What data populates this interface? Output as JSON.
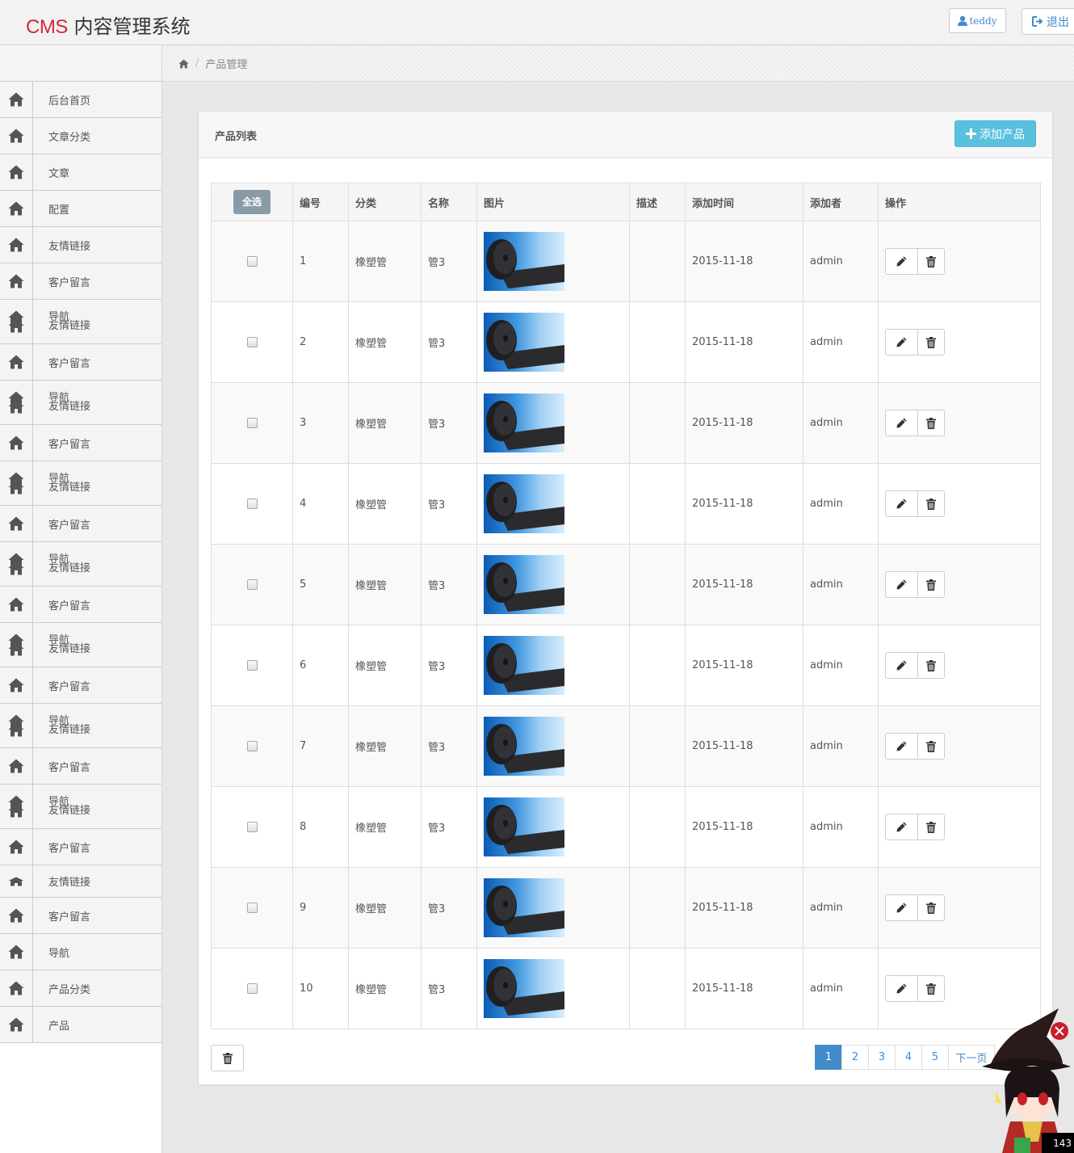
{
  "header": {
    "brand_cms": "CMS",
    "brand_rest": " 内容管理系统",
    "user_label": "teddy",
    "logout_label": "退出"
  },
  "breadcrumb": {
    "current": "产品管理",
    "separator": "/"
  },
  "sidebar": {
    "items": [
      {
        "label": "后台首页",
        "tall": false
      },
      {
        "label": "文章分类",
        "tall": false
      },
      {
        "label": "文章",
        "tall": false
      },
      {
        "label": "配置",
        "tall": false
      },
      {
        "label": "友情链接",
        "tall": false
      },
      {
        "label": "客户留言",
        "tall": false
      },
      {
        "label": "导航",
        "label2": "友情链接",
        "tall": true
      },
      {
        "label": "客户留言",
        "tall": false
      },
      {
        "label": "导航",
        "label2": "友情链接",
        "tall": true
      },
      {
        "label": "客户留言",
        "tall": false
      },
      {
        "label": "导航",
        "label2": "友情链接",
        "tall": true
      },
      {
        "label": "客户留言",
        "tall": false
      },
      {
        "label": "导航",
        "label2": "友情链接",
        "tall": true
      },
      {
        "label": "客户留言",
        "tall": false
      },
      {
        "label": "导航",
        "label2": "友情链接",
        "tall": true
      },
      {
        "label": "客户留言",
        "tall": false
      },
      {
        "label": "导航",
        "label2": "友情链接",
        "tall": true
      },
      {
        "label": "客户留言",
        "tall": false
      },
      {
        "label": "导航",
        "label2": "友情链接",
        "tall": true
      },
      {
        "label": "客户留言",
        "tall": false
      },
      {
        "label": "友情链接",
        "tall": false,
        "short": true
      },
      {
        "label": "客户留言",
        "tall": false
      },
      {
        "label": "导航",
        "tall": false
      },
      {
        "label": "产品分类",
        "tall": false
      },
      {
        "label": "产品",
        "tall": false
      }
    ]
  },
  "panel": {
    "title": "产品列表",
    "add_button": "添加产品"
  },
  "table": {
    "select_all": "全选",
    "headers": [
      "编号",
      "分类",
      "名称",
      "图片",
      "描述",
      "添加时间",
      "添加者",
      "操作"
    ],
    "rows": [
      {
        "id": "1",
        "category": "橡塑管",
        "name": "管3",
        "desc": "",
        "date": "2015-11-18",
        "author": "admin"
      },
      {
        "id": "2",
        "category": "橡塑管",
        "name": "管3",
        "desc": "",
        "date": "2015-11-18",
        "author": "admin"
      },
      {
        "id": "3",
        "category": "橡塑管",
        "name": "管3",
        "desc": "",
        "date": "2015-11-18",
        "author": "admin"
      },
      {
        "id": "4",
        "category": "橡塑管",
        "name": "管3",
        "desc": "",
        "date": "2015-11-18",
        "author": "admin"
      },
      {
        "id": "5",
        "category": "橡塑管",
        "name": "管3",
        "desc": "",
        "date": "2015-11-18",
        "author": "admin"
      },
      {
        "id": "6",
        "category": "橡塑管",
        "name": "管3",
        "desc": "",
        "date": "2015-11-18",
        "author": "admin"
      },
      {
        "id": "7",
        "category": "橡塑管",
        "name": "管3",
        "desc": "",
        "date": "2015-11-18",
        "author": "admin"
      },
      {
        "id": "8",
        "category": "橡塑管",
        "name": "管3",
        "desc": "",
        "date": "2015-11-18",
        "author": "admin"
      },
      {
        "id": "9",
        "category": "橡塑管",
        "name": "管3",
        "desc": "",
        "date": "2015-11-18",
        "author": "admin"
      },
      {
        "id": "10",
        "category": "橡塑管",
        "name": "管3",
        "desc": "",
        "date": "2015-11-18",
        "author": "admin"
      }
    ]
  },
  "pagination": {
    "pages": [
      "1",
      "2",
      "3",
      "4",
      "5"
    ],
    "active": "1",
    "next": "下一页"
  },
  "overlay": {
    "counter": "143"
  },
  "colors": {
    "brand": "#d6263a",
    "primary": "#428bca",
    "info": "#5bc0de"
  }
}
